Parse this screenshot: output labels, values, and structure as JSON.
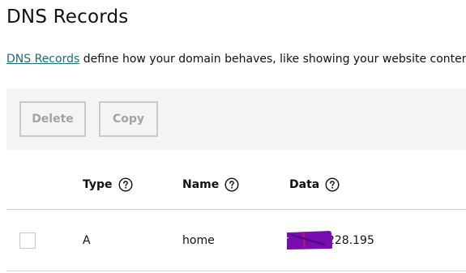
{
  "page": {
    "title": "DNS Records"
  },
  "intro": {
    "link_text": "DNS Records",
    "text": " define how your domain behaves, like showing your website content"
  },
  "toolbar": {
    "delete_label": "Delete",
    "copy_label": "Copy"
  },
  "table": {
    "columns": [
      {
        "label": "Type",
        "help_icon": "question-circle-icon"
      },
      {
        "label": "Name",
        "help_icon": "question-circle-icon"
      },
      {
        "label": "Data",
        "help_icon": "question-circle-icon"
      }
    ],
    "rows": [
      {
        "type": "A",
        "name": "home",
        "data": "97.20 .228.195",
        "checked": false
      }
    ]
  },
  "colors": {
    "link": "#1a6e74",
    "toolbar_bg": "#f4f4f4",
    "button_border": "#c9c9c9",
    "button_text": "#a3a3a3",
    "redaction": "#7a0db0"
  }
}
